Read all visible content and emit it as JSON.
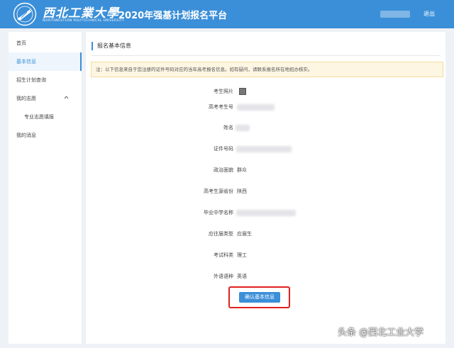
{
  "header": {
    "school_name_cn": "西北工業大學",
    "school_name_en": "NORTHWESTERN POLYTECHNICAL UNIVERSITY",
    "platform_title": "2020年强基计划报名平台",
    "logout_label": "退出",
    "accent_color": "#3b8fd8"
  },
  "sidebar": {
    "items": [
      {
        "label": "首页"
      },
      {
        "label": "基本信息"
      },
      {
        "label": "招生计划查询"
      },
      {
        "label": "我的志愿"
      },
      {
        "label": "专业志愿填报"
      },
      {
        "label": "我的消息"
      }
    ],
    "active_item": "基本信息",
    "expand_icon": "chevron-up-icon"
  },
  "main": {
    "section_title": "报名基本信息",
    "notice": "注：以下信息来自于您注册的证件号码对应的当年高考报名信息。如有疑问，请联系报名所在地招办核实。",
    "fields": [
      {
        "label": "考生照片",
        "value": ""
      },
      {
        "label": "高考考生号",
        "value": ""
      },
      {
        "label": "姓名",
        "value": ""
      },
      {
        "label": "证件号码",
        "value": ""
      },
      {
        "label": "政治面貌",
        "value": "群众"
      },
      {
        "label": "高考生源省份",
        "value": "陕西"
      },
      {
        "label": "毕业中学名称",
        "value": ""
      },
      {
        "label": "应往届类型",
        "value": "应届生"
      },
      {
        "label": "考试科类",
        "value": "理工"
      },
      {
        "label": "外语语种",
        "value": "英语"
      }
    ],
    "confirm_button": "确认基本信息",
    "highlight_color": "#e02020"
  },
  "watermark": "头条 @西北工业大学"
}
